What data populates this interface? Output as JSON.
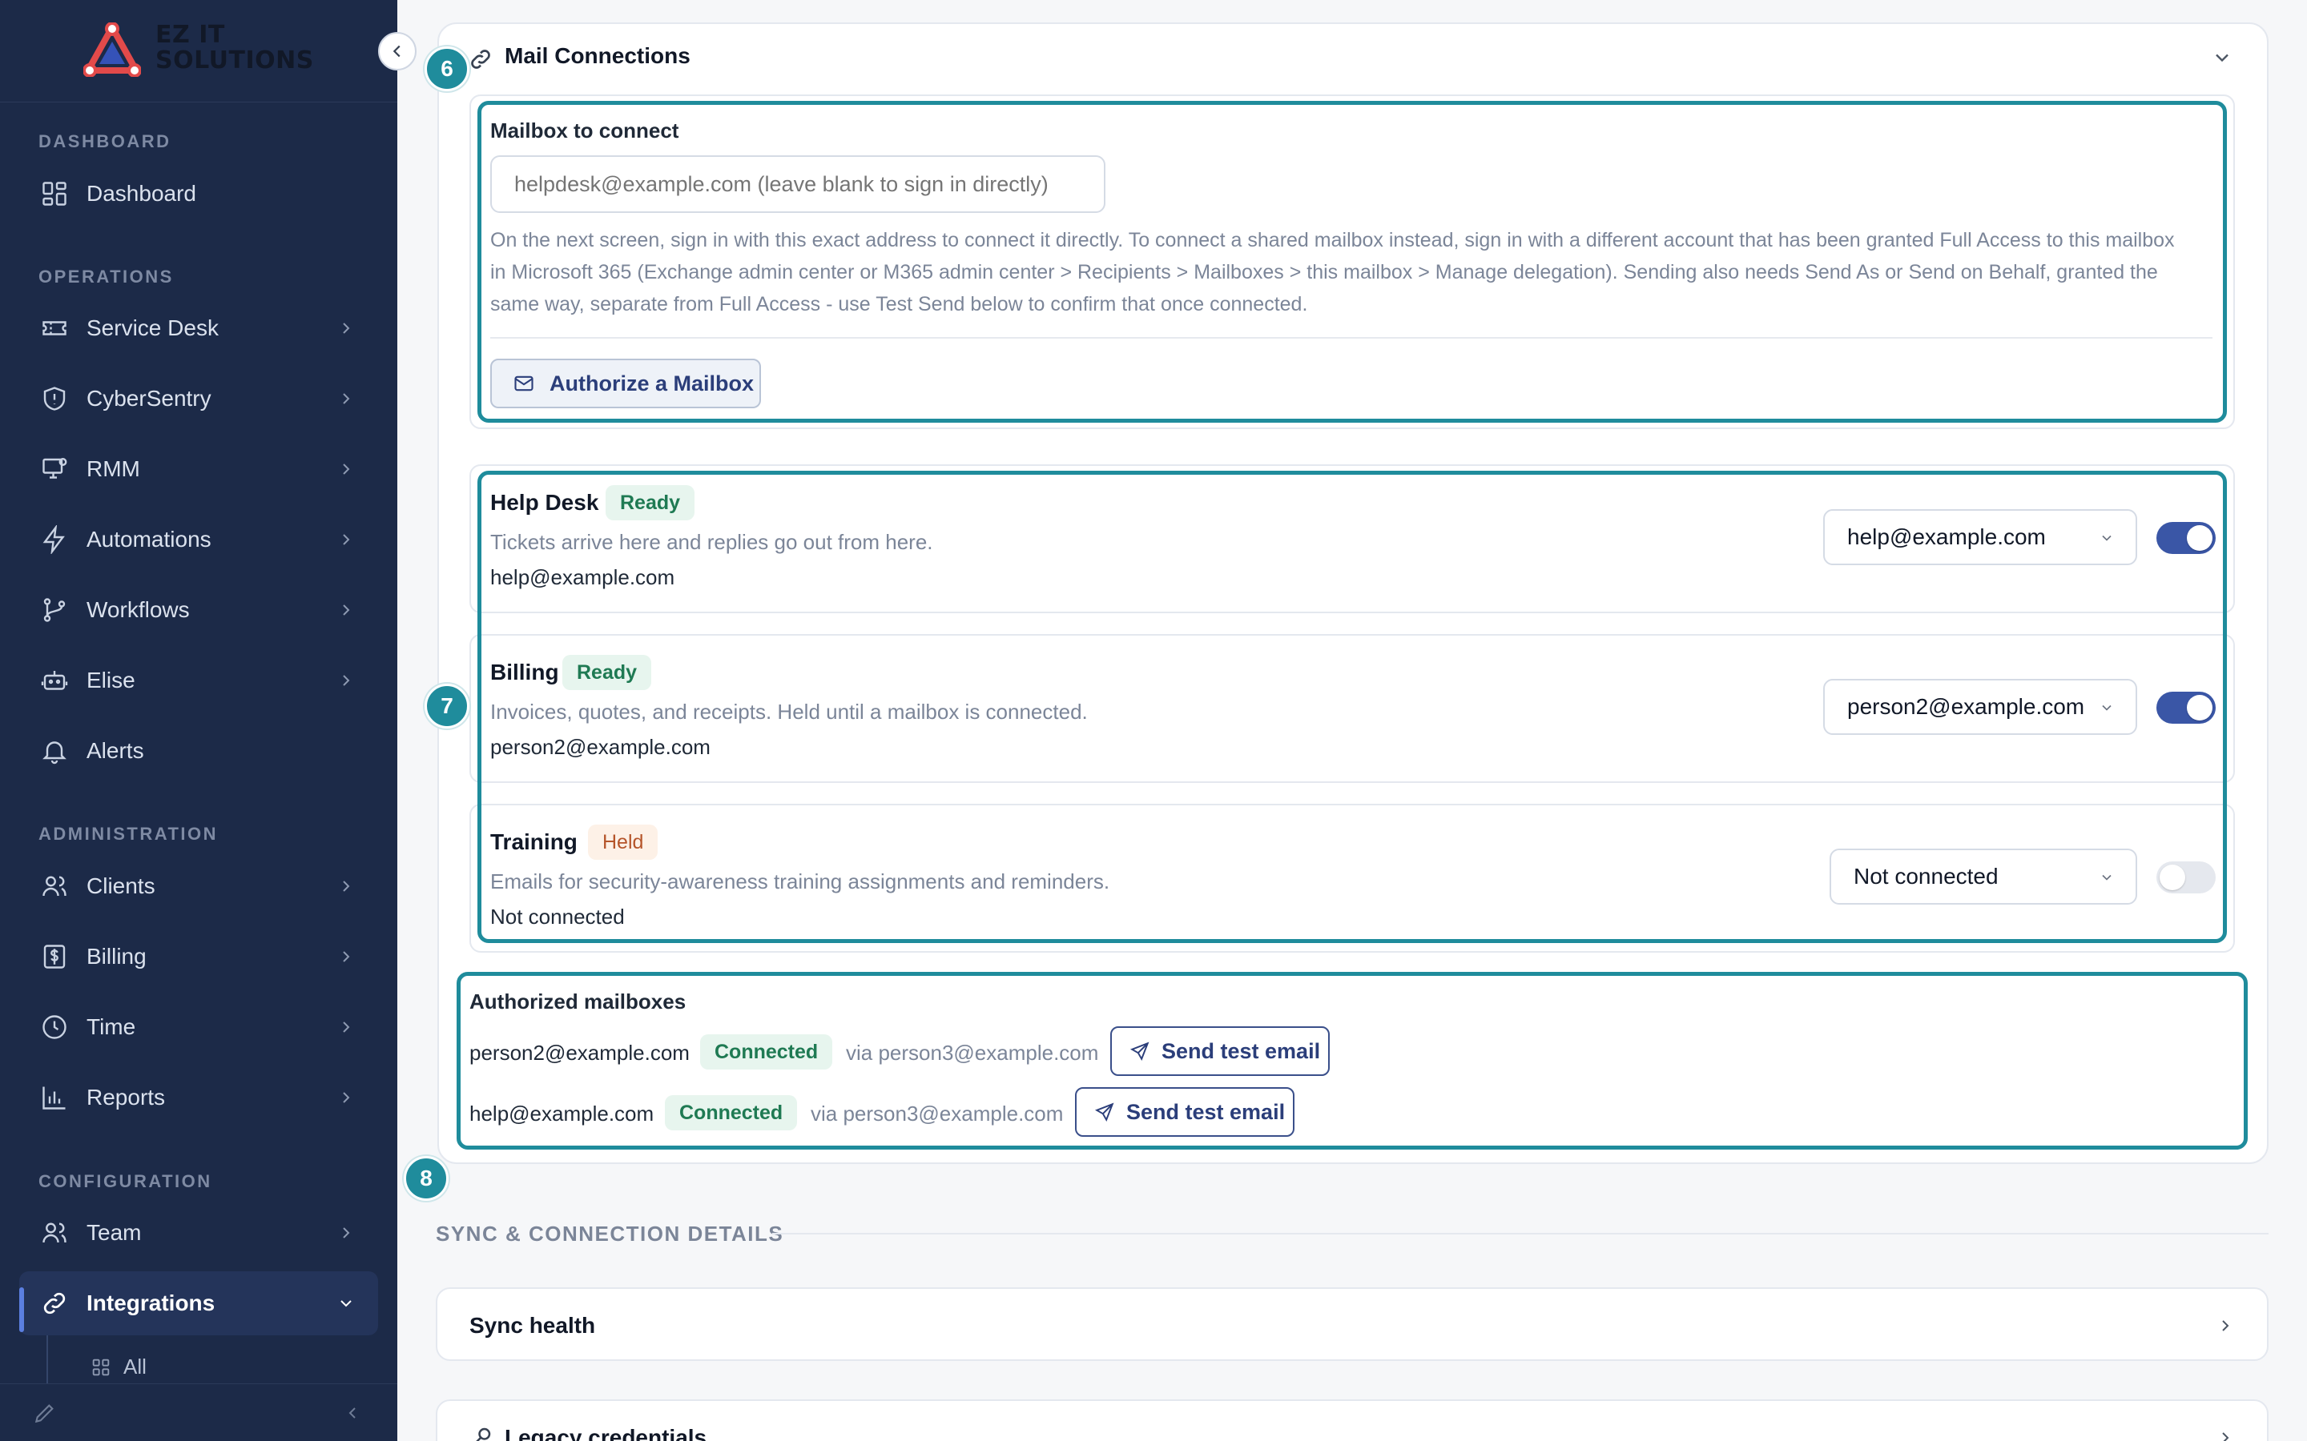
{
  "brand": {
    "name_line1": "EZ IT",
    "name_line2": "SOLUTIONS"
  },
  "sidebar": {
    "sections": [
      {
        "label": "DASHBOARD"
      },
      {
        "label": "OPERATIONS"
      },
      {
        "label": "ADMINISTRATION"
      },
      {
        "label": "CONFIGURATION"
      }
    ],
    "items": [
      {
        "label": "Dashboard",
        "icon": "dashboard-grid-icon"
      },
      {
        "label": "Service Desk",
        "icon": "ticket-icon"
      },
      {
        "label": "CyberSentry",
        "icon": "shield-icon"
      },
      {
        "label": "RMM",
        "icon": "monitor-icon"
      },
      {
        "label": "Automations",
        "icon": "lightning-icon"
      },
      {
        "label": "Workflows",
        "icon": "branch-icon"
      },
      {
        "label": "Elise",
        "icon": "robot-icon"
      },
      {
        "label": "Alerts",
        "icon": "bell-icon"
      },
      {
        "label": "Clients",
        "icon": "users-icon"
      },
      {
        "label": "Billing",
        "icon": "dollar-icon"
      },
      {
        "label": "Time",
        "icon": "clock-icon"
      },
      {
        "label": "Reports",
        "icon": "bar-chart-icon"
      },
      {
        "label": "Team",
        "icon": "team-icon"
      },
      {
        "label": "Integrations",
        "icon": "link-icon"
      }
    ],
    "sub_items": [
      {
        "label": "All",
        "icon": "grid-small-icon"
      }
    ]
  },
  "mail": {
    "title": "Mail Connections",
    "steps": [
      "6",
      "7",
      "8"
    ],
    "mailbox_label": "Mailbox to connect",
    "mailbox_placeholder": "helpdesk@example.com (leave blank to sign in directly)",
    "help_text": "On the next screen, sign in with this exact address to connect it directly. To connect a shared mailbox instead, sign in with a different account that has been granted Full Access to this mailbox in Microsoft 365 (Exchange admin center or M365 admin center > Recipients > Mailboxes > this mailbox > Manage delegation). Sending also needs Send As or Send on Behalf, granted the same way, separate from Full Access - use Test Send below to confirm that once connected.",
    "authorize_label": "Authorize a Mailbox",
    "purposes": [
      {
        "title": "Help Desk",
        "status": "Ready",
        "description": "Tickets arrive here and replies go out from here.",
        "address": "help@example.com",
        "selected": "help@example.com",
        "enabled": true
      },
      {
        "title": "Billing",
        "status": "Ready",
        "description": "Invoices, quotes, and receipts. Held until a mailbox is connected.",
        "address": "person2@example.com",
        "selected": "person2@example.com",
        "enabled": true
      },
      {
        "title": "Training",
        "status": "Held",
        "description": "Emails for security-awareness training assignments and reminders.",
        "address": "Not connected",
        "selected": "Not connected",
        "enabled": false
      }
    ],
    "authorized_label": "Authorized mailboxes",
    "authorized": [
      {
        "address": "person2@example.com",
        "status": "Connected",
        "via": "via person3@example.com",
        "button": "Send test email"
      },
      {
        "address": "help@example.com",
        "status": "Connected",
        "via": "via person3@example.com",
        "button": "Send test email"
      }
    ]
  },
  "sync": {
    "heading": "SYNC & CONNECTION DETAILS",
    "rows": [
      {
        "title": "Sync health"
      },
      {
        "title": "Legacy credentials"
      }
    ]
  },
  "colors": {
    "sidebar_bg": "#1c2a48",
    "accent_teal": "#1f8c9c",
    "toggle_on": "#3a56a6",
    "ready_green": "#1f7a53",
    "held_orange": "#b5552a"
  }
}
